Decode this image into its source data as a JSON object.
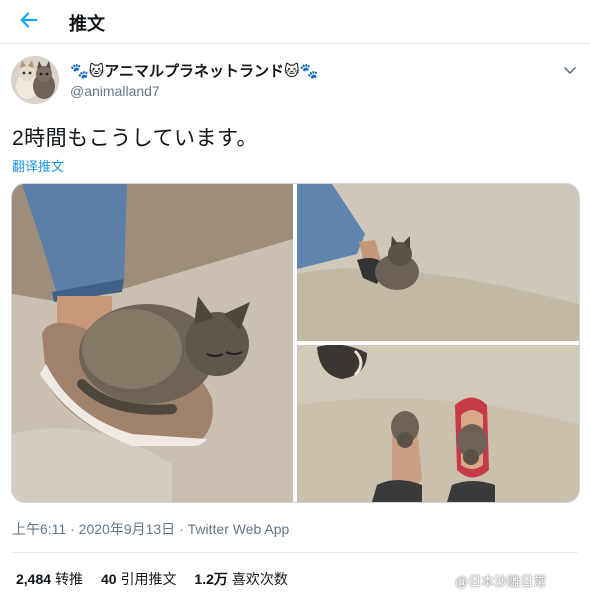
{
  "header": {
    "title": "推文"
  },
  "author": {
    "display_name": "🐾🐱アニマルプラネットランド🐱🐾",
    "handle": "@animalland7"
  },
  "tweet": {
    "text": "2時間もこうしています。",
    "translate_label": "翻译推文",
    "time": "上午6:11",
    "date": "2020年9月13日",
    "separator": "·",
    "source": "Twitter Web App"
  },
  "stats": {
    "retweets_count": "2,484",
    "retweets_label": "转推",
    "quotes_count": "40",
    "quotes_label": "引用推文",
    "likes_count": "1.2万",
    "likes_label": "喜欢次数"
  },
  "watermark": {
    "text": "@日本沙雕日常"
  },
  "colors": {
    "accent": "#1da1f2",
    "link": "#1b95e0",
    "muted": "#657786",
    "divider": "#e6ecf0"
  },
  "icons": {
    "back": "back-arrow-icon",
    "more": "chevron-down-icon"
  }
}
